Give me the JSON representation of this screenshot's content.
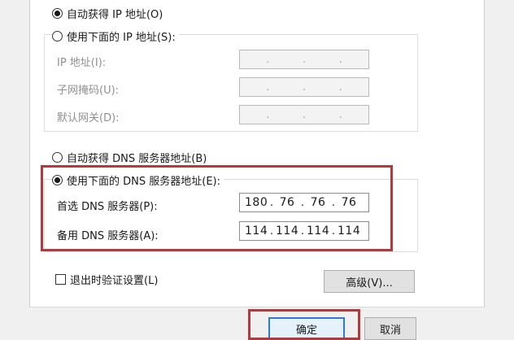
{
  "ip_section": {
    "auto_ip_label": "自动获得 IP 地址(O)",
    "manual_ip_label": "使用下面的 IP 地址(S):",
    "fields": [
      {
        "label": "IP 地址(I):",
        "octets": [
          "",
          "",
          "",
          ""
        ]
      },
      {
        "label": "子网掩码(U):",
        "octets": [
          "",
          "",
          "",
          ""
        ]
      },
      {
        "label": "默认网关(D):",
        "octets": [
          "",
          "",
          "",
          ""
        ]
      }
    ]
  },
  "dns_section": {
    "auto_dns_label": "自动获得 DNS 服务器地址(B)",
    "manual_dns_label": "使用下面的 DNS 服务器地址(E):",
    "preferred": {
      "label": "首选 DNS 服务器(P):",
      "octets": [
        "180",
        "76",
        "76",
        "76"
      ]
    },
    "alternate": {
      "label": "备用 DNS 服务器(A):",
      "octets": [
        "114",
        "114",
        "114",
        "114"
      ]
    }
  },
  "validate_label": "退出时验证设置(L)",
  "buttons": {
    "advanced": "高级(V)...",
    "ok": "确定",
    "cancel": "取消"
  },
  "colors": {
    "highlight": "#b23a3f",
    "primary_button_border": "#2b79d9"
  }
}
